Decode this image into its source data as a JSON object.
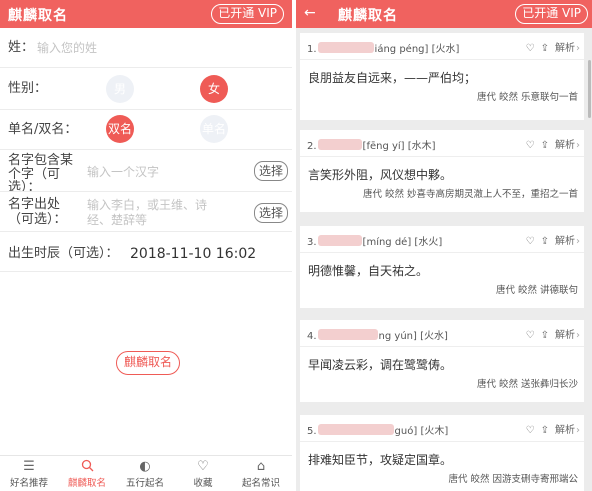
{
  "left": {
    "title": "麒麟取名",
    "vip": "已开通 VIP",
    "surname": {
      "label": "姓：",
      "placeholder": "输入您的姓"
    },
    "gender": {
      "label": "性别：",
      "male": "男",
      "female": "女"
    },
    "namelen": {
      "label": "单名/双名：",
      "double": "双名",
      "single": "单名"
    },
    "include": {
      "label_line1": "名字包含某",
      "label_line2": "个字（可",
      "label_line3": "选）：",
      "placeholder": "输入一个汉字",
      "button": "选择"
    },
    "source": {
      "label_line1": "名字出处",
      "label_line2": "（可选）：",
      "placeholder_line1": "输入李白，或王维、诗",
      "placeholder_line2": "经、楚辞等",
      "button": "选择"
    },
    "birth": {
      "label": "出生时辰（可选）：",
      "value": "2018-11-10 16:02"
    },
    "main_button": "麒麟取名",
    "nav": [
      {
        "label": "好名推荐",
        "icon": "list-icon"
      },
      {
        "label": "麒麟取名",
        "icon": "search-icon"
      },
      {
        "label": "五行起名",
        "icon": "yin-yang-icon"
      },
      {
        "label": "收藏",
        "icon": "heart-icon"
      },
      {
        "label": "起名常识",
        "icon": "home-icon"
      }
    ]
  },
  "right": {
    "title": "麒麟取名",
    "vip": "已开通 VIP",
    "actions": {
      "detail": "解析"
    },
    "cards": [
      {
        "num": "1.",
        "pinyin": "iáng péng]",
        "element": "[火水]",
        "verse": "良朋益友自远来，——严伯均；",
        "source": "唐代 皎然 乐意联句一首"
      },
      {
        "num": "2.",
        "pinyin": "[fēng yí]",
        "element": "[水木]",
        "verse": "言笑形外阻，风仪想中夥。",
        "source": "唐代 皎然 妙喜寺高房期灵澈上人不至，重招之一首"
      },
      {
        "num": "3.",
        "pinyin": "[míng dé]",
        "element": "[水火]",
        "verse": "明德惟馨，自天祐之。",
        "source": "唐代 皎然 讲德联句"
      },
      {
        "num": "4.",
        "pinyin": "ng yún]",
        "element": "[火水]",
        "verse": "早闻凌云彩，调在鹭鹭俦。",
        "source": "唐代 皎然 送张彝归长沙"
      },
      {
        "num": "5.",
        "pinyin": "guó]",
        "element": "[火木]",
        "verse": "排难知臣节，攻疑定国章。",
        "source": "唐代 皎然 因游支硎寺寄邢端公"
      }
    ]
  },
  "colors": {
    "brand": "#f0625f",
    "accent": "#ef5b56"
  }
}
